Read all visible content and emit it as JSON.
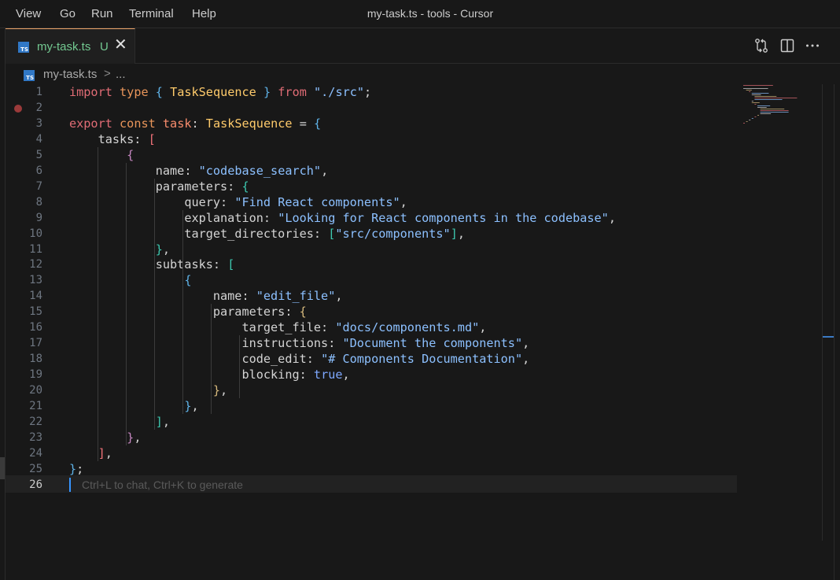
{
  "titlebar": {
    "menu": [
      "View",
      "Go",
      "Run",
      "Terminal",
      "Help"
    ],
    "window_title": "my-task.ts - tools - Cursor"
  },
  "tab": {
    "label": "my-task.ts",
    "status": "U",
    "close": "✕",
    "icon": "typescript-file-icon"
  },
  "actions": [
    "git-compare-icon",
    "split-editor-icon",
    "more-actions-icon"
  ],
  "breadcrumb": {
    "file": "my-task.ts",
    "separator": ">",
    "more": "..."
  },
  "editor": {
    "language": "typescript",
    "current_line": 26,
    "breakpoint_line": 2,
    "hint": "Ctrl+L to chat, Ctrl+K to generate",
    "line_numbers": [
      "1",
      "2",
      "3",
      "4",
      "5",
      "6",
      "7",
      "8",
      "9",
      "10",
      "11",
      "12",
      "13",
      "14",
      "15",
      "16",
      "17",
      "18",
      "19",
      "20",
      "21",
      "22",
      "23",
      "24",
      "25",
      "26"
    ],
    "lines": [
      "import type { TaskSequence } from \"./src\";",
      "",
      "export const task: TaskSequence = {",
      "    tasks: [",
      "        {",
      "            name: \"codebase_search\",",
      "            parameters: {",
      "                query: \"Find React components\",",
      "                explanation: \"Looking for React components in the codebase\",",
      "                target_directories: [\"src/components\"],",
      "            },",
      "            subtasks: [",
      "                {",
      "                    name: \"edit_file\",",
      "                    parameters: {",
      "                        target_file: \"docs/components.md\",",
      "                        instructions: \"Document the components\",",
      "                        code_edit: \"# Components Documentation\",",
      "                        blocking: true,",
      "                    },",
      "                },",
      "            ],",
      "        },",
      "    ],",
      "};",
      ""
    ]
  },
  "colors": {
    "background": "#181818",
    "tab_accent": "#e8a166",
    "untracked_green": "#73c991",
    "cursor_blue": "#3794ff"
  }
}
